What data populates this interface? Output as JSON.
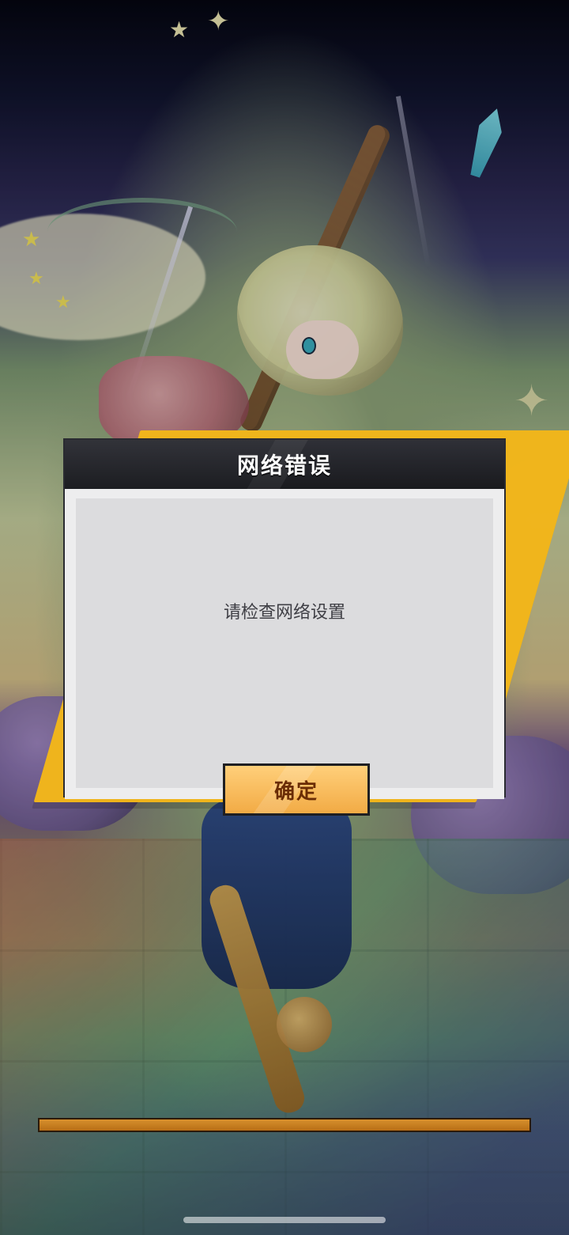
{
  "dialog": {
    "title": "网络错误",
    "message": "请检查网络设置",
    "confirm_label": "确定"
  },
  "loading": {
    "progress": 1.0
  },
  "colors": {
    "dialog_accent": "#f2b61b",
    "dialog_header": "#1a1b20",
    "dialog_body": "#dcdcde",
    "button_fill": "#ffcf7a",
    "button_text": "#6a2c05",
    "loading_bar": "#c97a1d"
  },
  "icons": {
    "home_indicator": "home-indicator-icon"
  }
}
